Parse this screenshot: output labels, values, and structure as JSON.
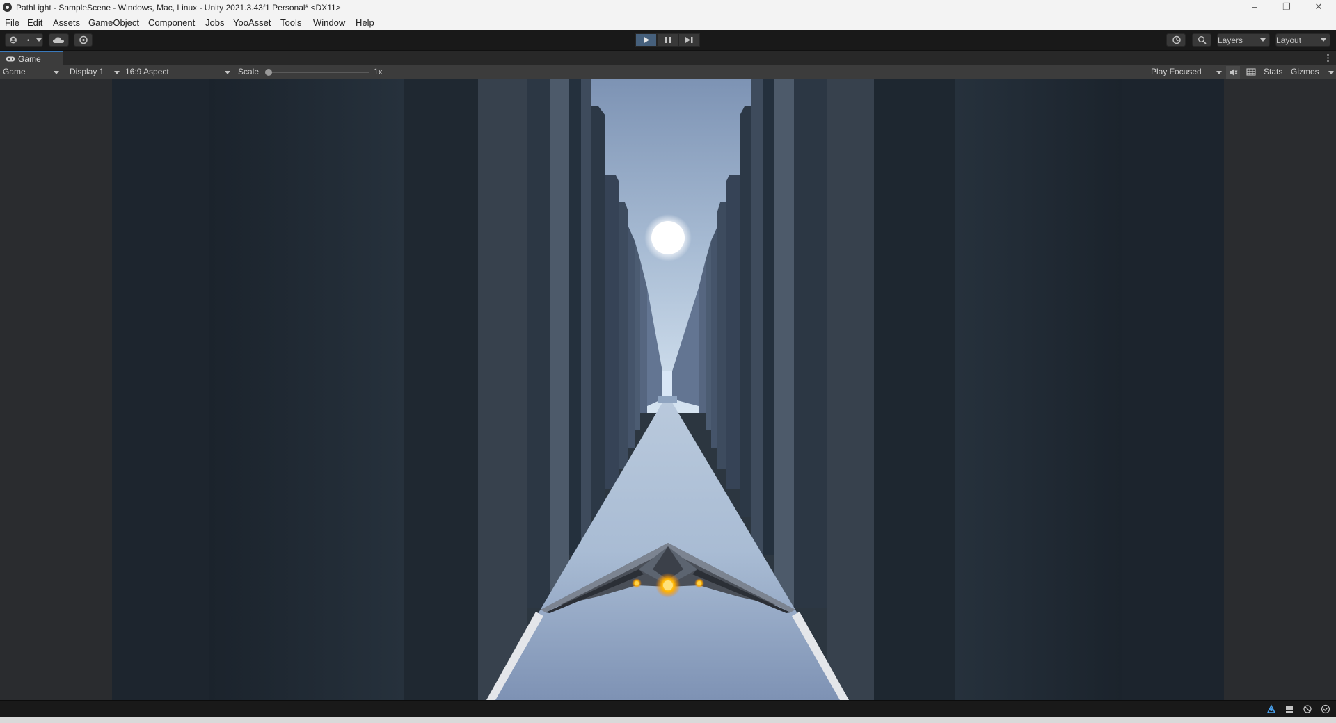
{
  "window": {
    "title": "PathLight - SampleScene - Windows, Mac, Linux - Unity 2021.3.43f1 Personal* <DX11>",
    "minimize": "–",
    "restore": "❐",
    "close": "✕"
  },
  "menu": [
    "File",
    "Edit",
    "Assets",
    "GameObject",
    "Component",
    "Jobs",
    "YooAsset",
    "Tools",
    "Window",
    "Help"
  ],
  "toolbar": {
    "account_label": "",
    "layers_label": "Layers",
    "layout_label": "Layout",
    "play_state": "playing"
  },
  "game_tab": {
    "label": "Game"
  },
  "game_bar": {
    "view_select": "Game",
    "display_select": "Display 1",
    "aspect_select": "16:9 Aspect",
    "scale_label": "Scale",
    "scale_value": "1x",
    "scale_fraction": 0,
    "play_mode_select": "Play Focused",
    "stats_label": "Stats",
    "gizmos_label": "Gizmos"
  },
  "colors": {
    "accent": "#3a79bb",
    "play_active": "#46607c",
    "editor_dark": "#191919",
    "panel": "#3c3c3c",
    "sky": "#c4d4e6",
    "ship_glow": "#ffb400"
  }
}
